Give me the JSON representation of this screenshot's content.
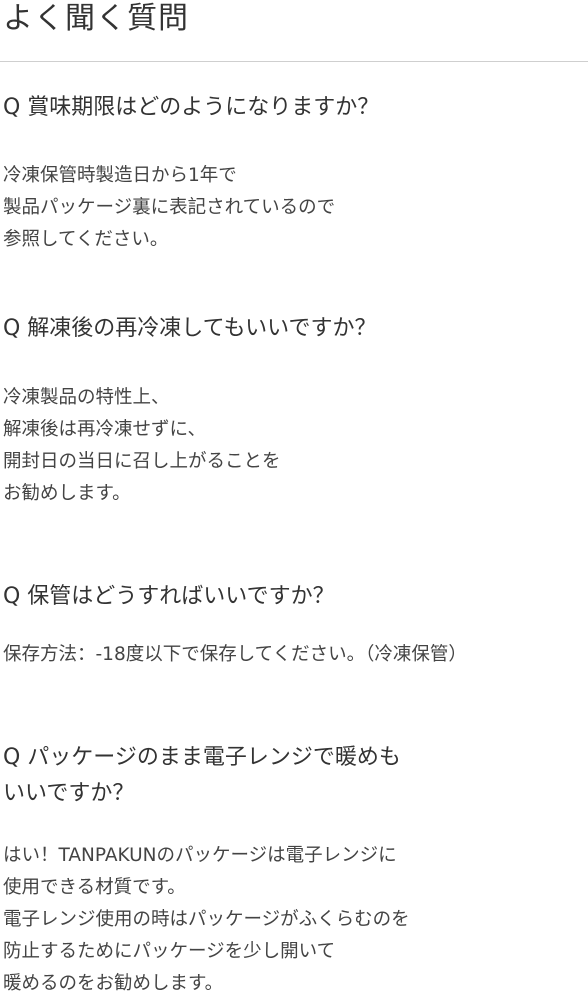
{
  "page": {
    "title": "よく聞く質問"
  },
  "faqs": [
    {
      "question": "Q 賞味期限はどのようになりますか？",
      "answer": "冷凍保管時製造日から1年で\n製品パッケージ裏に表記されているので\n参照してください。"
    },
    {
      "question": "Q  解凍後の再冷凍してもいいですか？",
      "answer": "冷凍製品の特性上、\n解凍後は再冷凍せずに、\n開封日の当日に召し上がることを\nお勧めします。"
    },
    {
      "question": "Q 保管はどうすればいいですか？",
      "answer": "保存方法：-18度以下で保存してください。（冷凍保管）"
    },
    {
      "question": "Q パッケージのまま電子レンジで暖めも\nいいですか？",
      "answer": "はい！TANPAKUNのパッケージは電子レンジに\n使用できる材質です。\n電子レンジ使用の時はパッケージがふくらむのを\n防止するためにパッケージを少し開いて\n暖めるのをお勧めします。"
    }
  ]
}
